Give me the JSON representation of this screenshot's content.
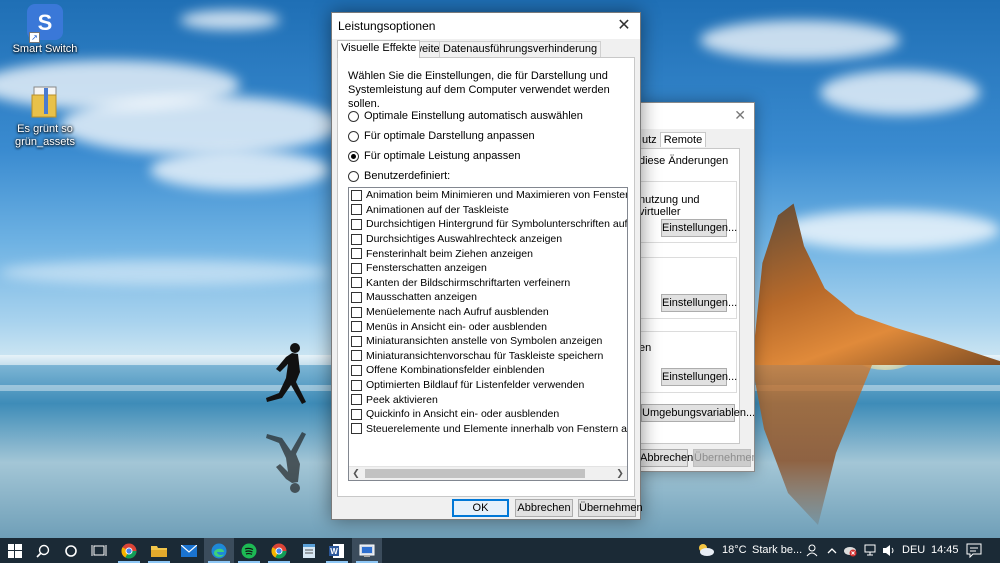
{
  "desktop": {
    "icons": [
      {
        "name": "smart-switch",
        "label": "Smart Switch",
        "icon": "samsung-smart-switch-icon",
        "color": "#3a78d8"
      },
      {
        "name": "folder",
        "label": "Es grünt so grün_assets",
        "icon": "folder-icon",
        "color": "#e8c14a"
      }
    ]
  },
  "bg_dialog": {
    "tabs": [
      "utz",
      "Remote"
    ],
    "note": "diese Änderungen",
    "group1_text": "nutzung und virtueller",
    "group3_text": "en",
    "settings_label": "Einstellungen...",
    "env_label": "Umgebungsvariablen...",
    "cancel_label": "Abbrechen",
    "apply_label": "Übernehmen"
  },
  "dialog": {
    "title": "Leistungsoptionen",
    "tabs": [
      "Visuelle Effekte",
      "Erweitert",
      "Datenausführungsverhinderung"
    ],
    "intro": "Wählen Sie die Einstellungen, die für Darstellung und Systemleistung auf dem Computer verwendet werden sollen.",
    "radios": [
      {
        "label": "Optimale Einstellung automatisch auswählen",
        "checked": false
      },
      {
        "label": "Für optimale Darstellung anpassen",
        "checked": false
      },
      {
        "label": "Für optimale Leistung anpassen",
        "checked": true
      },
      {
        "label": "Benutzerdefiniert:",
        "checked": false
      }
    ],
    "options": [
      "Animation beim Minimieren und Maximieren von Fenstern",
      "Animationen auf der Taskleiste",
      "Durchsichtigen Hintergrund für Symbolunterschriften auf dem D",
      "Durchsichtiges Auswahlrechteck anzeigen",
      "Fensterinhalt beim Ziehen anzeigen",
      "Fensterschatten anzeigen",
      "Kanten der Bildschirmschriftarten verfeinern",
      "Mausschatten anzeigen",
      "Menüelemente nach Aufruf ausblenden",
      "Menüs in Ansicht ein- oder ausblenden",
      "Miniaturansichten anstelle von Symbolen anzeigen",
      "Miniaturansichtenvorschau für Taskleiste speichern",
      "Offene Kombinationsfelder einblenden",
      "Optimierten Bildlauf für Listenfelder verwenden",
      "Peek aktivieren",
      "Quickinfo in Ansicht ein- oder ausblenden",
      "Steuerelemente und Elemente innerhalb von Fenstern animieren"
    ],
    "buttons": {
      "ok": "OK",
      "cancel": "Abbrechen",
      "apply": "Übernehmen"
    }
  },
  "taskbar": {
    "apps": [
      "start-icon",
      "search-icon",
      "cortana-icon",
      "task-view-icon",
      "chrome-icon",
      "file-explorer-icon",
      "mail-icon",
      "edge-icon",
      "spotify-icon",
      "chrome-profile-icon",
      "notepad-icon",
      "word-icon",
      "system-settings-icon"
    ],
    "temperature": "18°C",
    "weather_text": "Stark be...",
    "language": "DEU",
    "time": "14:45"
  }
}
